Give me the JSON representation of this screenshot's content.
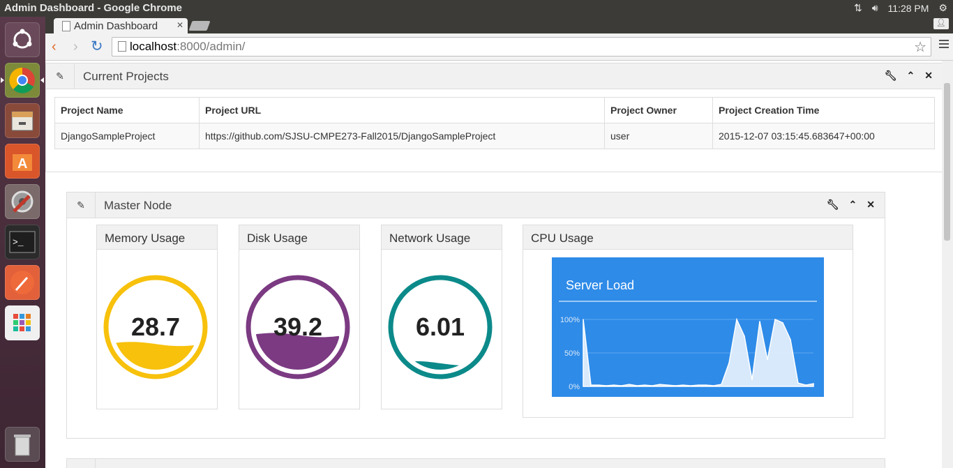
{
  "os": {
    "window_title": "Admin Dashboard - Google Chrome",
    "clock": "11:28 PM"
  },
  "browser": {
    "tab_title": "Admin Dashboard",
    "url_host": "localhost",
    "url_rest": ":8000/admin/"
  },
  "projects_widget": {
    "title": "Current Projects",
    "columns": [
      "Project Name",
      "Project URL",
      "Project Owner",
      "Project Creation Time"
    ],
    "rows": [
      [
        "DjangoSampleProject",
        "https://github.com/SJSU-CMPE273-Fall2015/DjangoSampleProject",
        "user",
        "2015-12-07 03:15:45.683647+00:00"
      ]
    ]
  },
  "master_widget": {
    "title": "Master Node",
    "gauges": [
      {
        "label": "Memory Usage",
        "value": "28.7",
        "fill_fraction": 0.287,
        "color": "#f7c10c"
      },
      {
        "label": "Disk Usage",
        "value": "39.2",
        "fill_fraction": 0.392,
        "color": "#7b3a82"
      },
      {
        "label": "Network Usage",
        "value": "6.01",
        "fill_fraction": 0.0601,
        "color": "#0c8a8a"
      }
    ],
    "cpu": {
      "label": "CPU Usage"
    }
  },
  "chart_data": {
    "type": "area",
    "title": "Server Load",
    "y_ticks": [
      "100%",
      "50%",
      "0%"
    ],
    "ylim": [
      0,
      100
    ],
    "values": [
      100,
      2,
      2,
      1,
      2,
      1,
      3,
      1,
      2,
      1,
      3,
      2,
      1,
      2,
      1,
      2,
      2,
      1,
      3,
      35,
      100,
      75,
      10,
      97,
      40,
      100,
      95,
      70,
      5,
      2,
      4
    ],
    "background": "#2e8be8",
    "fill": "#e6f1fc"
  }
}
